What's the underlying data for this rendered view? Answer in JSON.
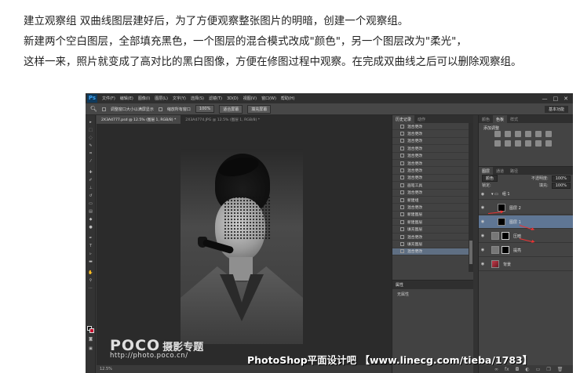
{
  "article": {
    "line1": "建立观察组 双曲线图层建好后，为了方便观察整张图片的明暗，创建一个观察组。",
    "line2": "新建两个空白图层，全部填充黑色，一个图层的混合模式改成\"颜色\"，另一个图层改为\"柔光\"，",
    "line3": "这样一来，照片就变成了高对比的黑白图像，方便在修图过程中观察。在完成双曲线之后可以删除观察组。"
  },
  "photoshop": {
    "logo": "Ps",
    "menu": [
      "文件(F)",
      "编辑(E)",
      "图像(I)",
      "图层(L)",
      "文字(Y)",
      "选择(S)",
      "滤镜(T)",
      "3D(D)",
      "视图(V)",
      "窗口(W)",
      "帮助(H)"
    ],
    "window_controls": [
      "—",
      "□",
      "✕"
    ],
    "options": {
      "fit_label": "调整窗口大小以满屏显示",
      "zoom_all_label": "缩放所有窗口",
      "btn_100": "100%",
      "btn_fit": "适合屏幕",
      "btn_fill": "填充屏幕",
      "workspace": "基本功能"
    },
    "tabs": [
      "2X3A4777.psd @ 12.5% (图层 1, RGB/8) *",
      "2X3A4774.JPG @ 12.5% (图层 1, RGB/8) *"
    ],
    "status": "12.5%",
    "history": {
      "tabs": [
        "历史记录",
        "动作"
      ],
      "rows": [
        "混合更改",
        "混合更改",
        "混合更改",
        "混合更改",
        "混合更改",
        "混合更改",
        "混合更改",
        "混合更改",
        "画笔工具",
        "混合更改",
        "新建组",
        "混合更改",
        "新建图层",
        "新建图层",
        "填充图层",
        "混合更改",
        "填充图层",
        "混合更改"
      ],
      "selected_index": 17
    },
    "properties": {
      "title": "属性",
      "value": "无属性"
    },
    "adjustments": {
      "tabs": [
        "颜色",
        "色板",
        "样式"
      ],
      "title": "添加调整"
    },
    "layers": {
      "tabs": [
        "图层",
        "通道",
        "路径"
      ],
      "blend_mode": "颜色",
      "opacity_label": "不透明度:",
      "opacity": "100%",
      "lock_label": "锁定:",
      "fill_label": "填充:",
      "fill": "100%",
      "rows": [
        {
          "name": "组 1",
          "type": "group"
        },
        {
          "name": "图层 2",
          "type": "layer"
        },
        {
          "name": "图层 1",
          "type": "layer"
        },
        {
          "name": "压暗",
          "type": "adjust"
        },
        {
          "name": "提亮",
          "type": "adjust"
        },
        {
          "name": "背景",
          "type": "photo"
        }
      ],
      "selected_index": 2
    }
  },
  "watermarks": {
    "poco": "POCO",
    "poco_sub": "摄影专题",
    "poco_url": "http://photo.poco.cn/",
    "right": "PhotoShop平面设计吧 【www.linecg.com/tieba/1783】"
  }
}
